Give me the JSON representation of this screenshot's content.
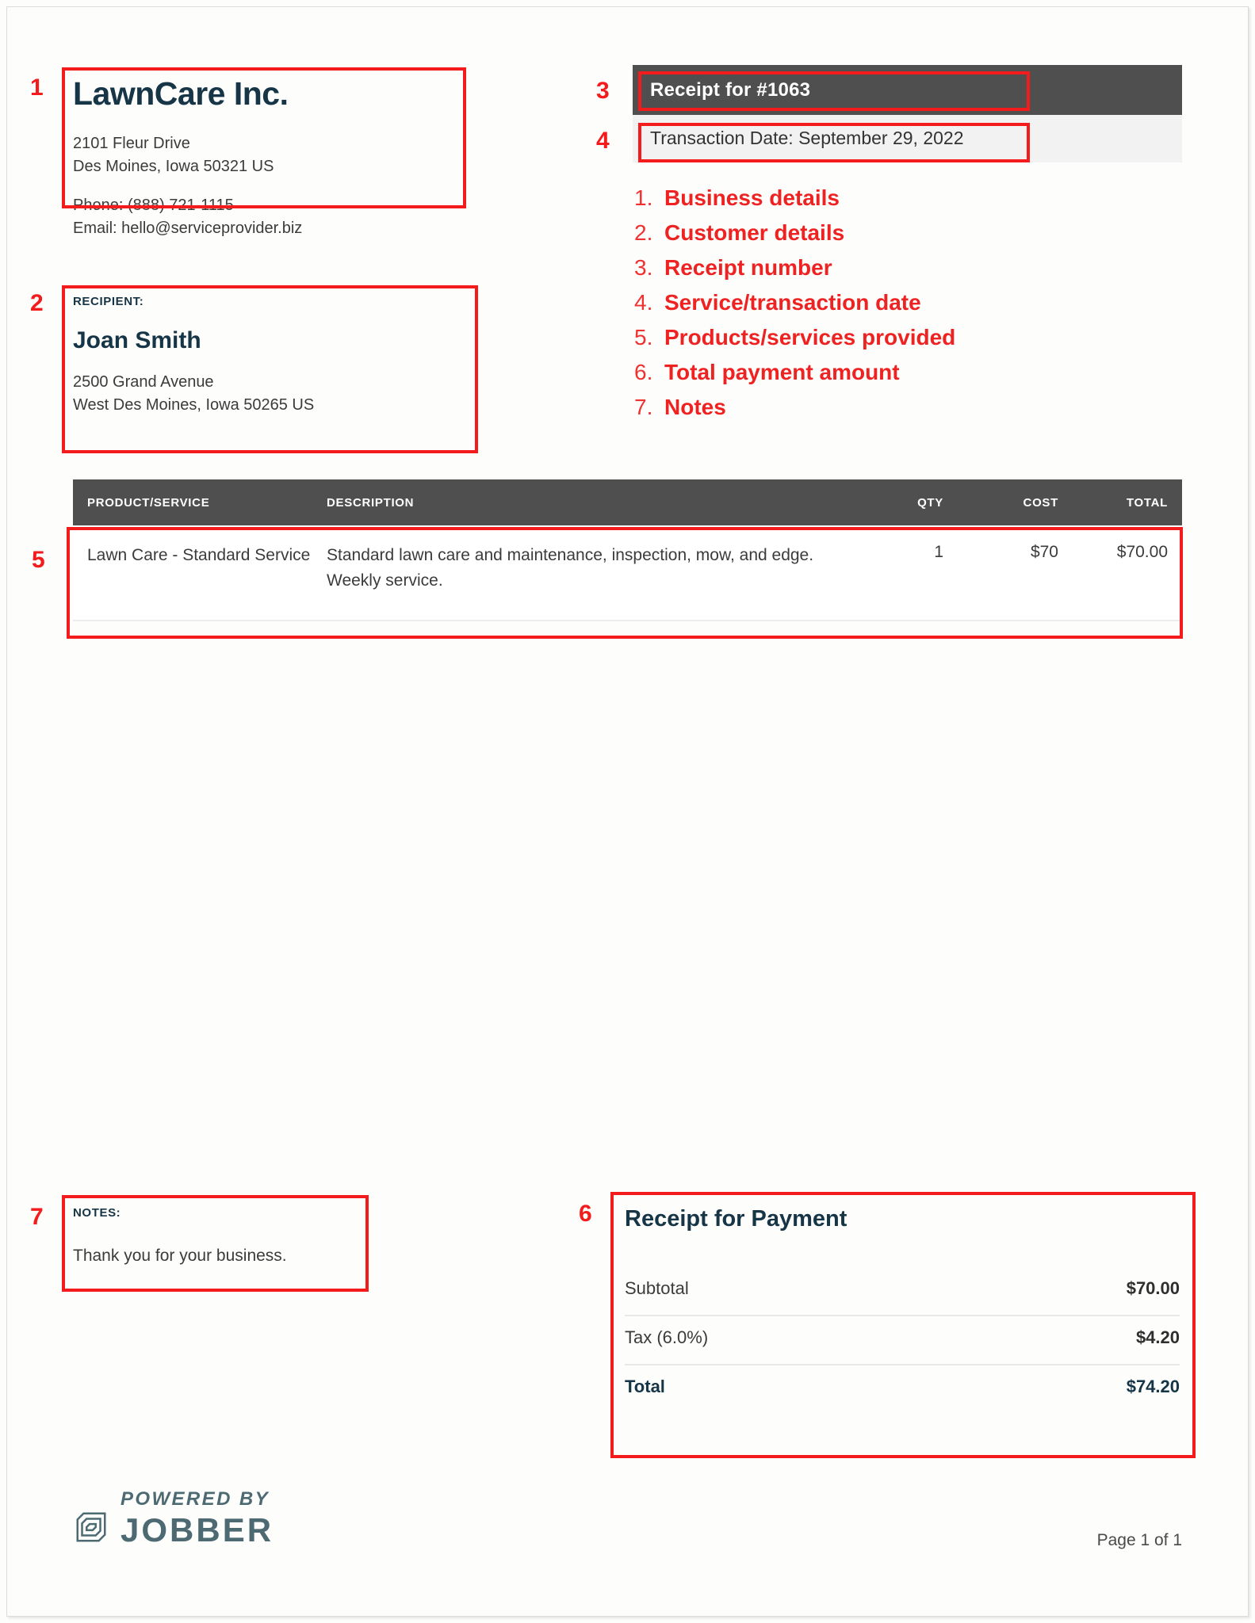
{
  "business": {
    "name": "LawnCare Inc.",
    "address_line1": "2101 Fleur Drive",
    "address_line2": "Des Moines, Iowa 50321 US",
    "phone": "Phone: (888) 721-1115",
    "email": "Email: hello@serviceprovider.biz"
  },
  "recipient": {
    "label": "RECIPIENT:",
    "name": "Joan Smith",
    "address_line1": "2500 Grand Avenue",
    "address_line2": "West Des Moines, Iowa 50265 US"
  },
  "header": {
    "receipt_title": "Receipt for #1063",
    "transaction_date": "Transaction Date: September 29, 2022"
  },
  "annotation_list": [
    {
      "num": "1.",
      "label": "Business details"
    },
    {
      "num": "2.",
      "label": "Customer details"
    },
    {
      "num": "3.",
      "label": "Receipt number"
    },
    {
      "num": "4.",
      "label": "Service/transaction date"
    },
    {
      "num": "5.",
      "label": "Products/services provided"
    },
    {
      "num": "6.",
      "label": "Total payment amount"
    },
    {
      "num": "7.",
      "label": "Notes"
    }
  ],
  "annotation_markers": {
    "m1": "1",
    "m2": "2",
    "m3": "3",
    "m4": "4",
    "m5": "5",
    "m6": "6",
    "m7": "7"
  },
  "table": {
    "columns": {
      "product": "PRODUCT/SERVICE",
      "description": "DESCRIPTION",
      "qty": "QTY",
      "cost": "COST",
      "total": "TOTAL"
    },
    "rows": [
      {
        "product": "Lawn Care - Standard Service",
        "description": "Standard lawn care and maintenance, inspection, mow, and edge. Weekly service.",
        "qty": "1",
        "cost": "$70",
        "total": "$70.00"
      }
    ]
  },
  "notes": {
    "label": "NOTES:",
    "body": "Thank you for your business."
  },
  "summary": {
    "title": "Receipt for Payment",
    "rows": [
      {
        "label": "Subtotal",
        "value": "$70.00"
      },
      {
        "label": "Tax (6.0%)",
        "value": "$4.20"
      },
      {
        "label": "Total",
        "value": "$74.20"
      }
    ]
  },
  "footer": {
    "powered_by": "POWERED BY",
    "brand": "JOBBER",
    "page": "Page 1 of 1"
  },
  "colors": {
    "annotation_red": "#f31b1b",
    "bar_dark": "#4f4f4f",
    "bar_light": "#f2f2f2",
    "brand_navy": "#163546",
    "jobber_teal": "#4d6a72"
  }
}
